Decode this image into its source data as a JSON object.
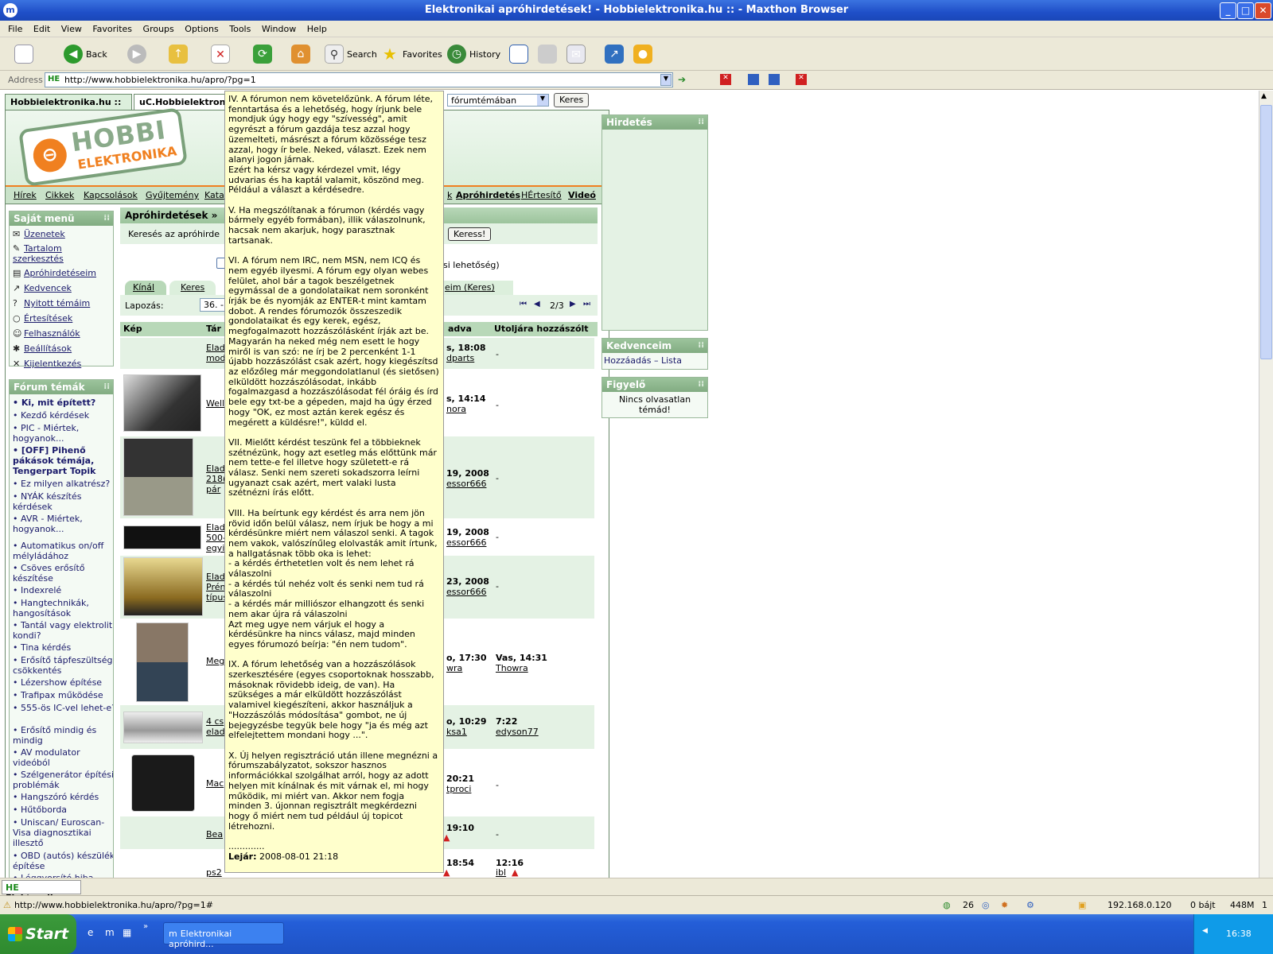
{
  "window": {
    "title": "Elektronikai apróhirdetések! - Hobbielektronika.hu :: - Maxthon Browser"
  },
  "menu": [
    "File",
    "Edit",
    "View",
    "Favorites",
    "Groups",
    "Options",
    "Tools",
    "Window",
    "Help"
  ],
  "toolbar": {
    "back": "Back",
    "search": "Search",
    "favorites": "Favorites",
    "history": "History"
  },
  "address": {
    "label": "Address",
    "url": "http://www.hobbielektronika.hu/apro/?pg=1"
  },
  "tabs": [
    "Hobbielektronika.hu ::",
    "uC.Hobbielektroni"
  ],
  "search_area": {
    "scope": "fórumtémában",
    "button": "Keres"
  },
  "nav": [
    "Hírek",
    "Cikkek",
    "Kapcsolások",
    "Gyűjtemény",
    "Kata",
    "k",
    "Apróhirdetés",
    "HÉrtesítő",
    "Videó"
  ],
  "sajat_menu": {
    "title": "Saját menü",
    "items": [
      "Üzenetek",
      "Tartalom szerkesztés",
      "Apróhirdetéseim",
      "Kedvencek",
      "Nyitott témáim",
      "Értesítések",
      "Felhasználók",
      "Beállítások",
      "Kijelentkezés"
    ]
  },
  "forum_temak": {
    "title": "Fórum témák",
    "items": [
      "Ki, mit épített?",
      "Kezdő kérdések",
      "PIC - Miértek, hogyanok...",
      "[OFF] Pihenő pákások témája, Tengerpart Topik",
      "Ez milyen alkatrész?",
      "NYÁK készítés kérdések",
      "AVR - Miértek, hogyanok...",
      "Automatikus on/off mélyládához",
      "Csöves erősítő készítése",
      "Indexrelé",
      "Hangtechnikák, hangosítások",
      "Tantál vagy elektrolit kondi?",
      "Tina kérdés",
      "Erősítő tápfeszültség csökkentés",
      "Lézershow építése",
      "Trafipax működése",
      "555-ös IC-vel lehet-e?",
      "Erősítő mindig és mindig",
      "AV modulator videóból",
      "Szélgenerátor építési problémák",
      "Hangszóró kérdés",
      "Hűtőborda",
      "Uniscan/ Euroscan-Visa diagnosztikai illesztő",
      "OBD (autós) készülék építése",
      "Léggyorsító hiba"
    ]
  },
  "main": {
    "title": "Apróhirdetések »",
    "search_label": "Keresés az apróhirde",
    "search_button": "Keress!",
    "extra_text": "si lehetőség)",
    "subtabs": [
      "Kínál",
      "Keres",
      "eim (Keres)"
    ],
    "paging_label": "Lapozás:",
    "paging_value": "36. - 70. hirdetés",
    "page_of": "2/3",
    "columns": [
      "Kép",
      "Tár",
      "adva",
      "Utoljára hozzászólt"
    ],
    "rows": [
      {
        "title": "Elad",
        "title2": "mod",
        "added": "s, 18:08",
        "added_user": "dparts",
        "last": "-",
        "last_user": ""
      },
      {
        "title": "Well",
        "title2": "",
        "added": "s, 14:14",
        "added_user": "nora",
        "last": "-",
        "last_user": ""
      },
      {
        "title": "Elad",
        "title2": "218(",
        "title3": "pár",
        "added": "19, 2008",
        "added_user": "essor666",
        "last": "-",
        "last_user": ""
      },
      {
        "title": "Elad",
        "title2": "500-",
        "title3": "egyi",
        "added": "19, 2008",
        "added_user": "essor666",
        "last": "-",
        "last_user": ""
      },
      {
        "title": "Elad",
        "title2": "Prén",
        "title3": "típus",
        "added": "23, 2008",
        "added_user": "essor666",
        "last": "-",
        "last_user": ""
      },
      {
        "title": "Meg",
        "title2": "",
        "added": "o, 17:30",
        "added_user": "wra",
        "last": "Vas, 14:31",
        "last_user": "Thowra"
      },
      {
        "title": "4 cs",
        "title2": "elad",
        "added": "o, 10:29",
        "added_user": "ksa1",
        "last": "7:22",
        "last_user": "edyson77"
      },
      {
        "title": "Mac",
        "title2": "",
        "added": "20:21",
        "added_user": "tproci",
        "last": "-",
        "last_user": ""
      },
      {
        "title": "Bea",
        "title2": "",
        "added": "19:10",
        "added_user": "",
        "last": "-",
        "last_user": ""
      },
      {
        "title": "ps2",
        "title2": "",
        "added": "18:54",
        "added_user": "",
        "last": "12:16",
        "last_user": "ibl"
      }
    ]
  },
  "tooltip": {
    "text": "IV. A fórumon nem követelőzünk. A fórum léte, fenntartása és a lehetőség, hogy írjunk bele mondjuk úgy hogy egy \"szívesség\", amit egyrészt a fórum gazdája tesz azzal hogy üzemelteti, másrészt a fórum közössége tesz azzal, hogy ír bele. Neked, választ. Ezek nem alanyi jogon járnak.\nEzért ha kérsz vagy kérdezel vmit, légy udvarias és ha kaptál valamit, köszönd meg. Például a választ a kérdésedre.\n\nV. Ha megszólítanak a fórumon (kérdés vagy bármely egyéb formában), illik válaszolnunk, hacsak nem akarjuk, hogy parasztnak tartsanak.\n\nVI. A fórum nem IRC, nem MSN, nem ICQ és nem egyéb ilyesmi. A fórum egy olyan webes felület, ahol bár a tagok beszélgetnek egymással de a gondolataikat nem soronként írják be és nyomják az ENTER-t mint kamtam dobot. A rendes fórumozók összeszedik gondolataikat és egy kerek, egész, megfogalmazott hozzászólásként írják azt be.\nMagyarán ha neked még nem esett le hogy miről is van szó: ne írj be 2 percenként 1-1 újabb hozzászólást csak azért, hogy kiegészítsd az előzőleg már meggondolatlanul (és sietősen) elküldött hozzászólásodat, inkább fogalmazgasd a hozzászólásodat fél óráig és írd bele egy txt-be a gépeden, majd ha úgy érzed hogy \"OK, ez most aztán kerek egész és megérett a küldésre!\", küldd el.\n\nVII. Mielőtt kérdést teszünk fel a többieknek szétnézünk, hogy azt esetleg más előttünk már nem tette-e fel illetve hogy született-e rá válasz. Senki nem szereti sokadszorra leírni ugyanazt csak azért, mert valaki lusta szétnézni írás előtt.\n\nVIII. Ha beírtunk egy kérdést és arra nem jön rövid időn belül válasz, nem írjuk be hogy a mi kérdésünkre miért nem válaszol senki. A tagok nem vakok, valószínűleg elolvasták amit írtunk, a hallgatásnak több oka is lehet:\n- a kérdés érthetetlen volt és nem lehet rá válaszolni\n- a kérdés túl nehéz volt és senki nem tud rá válaszolni\n- a kérdés már milliószor elhangzott és senki nem akar újra rá válaszolni\nAzt meg ugye nem várjuk el hogy a kérdésünkre ha nincs válasz, majd minden egyes fórumozó beírja: \"én nem tudom\".\n\nIX. A fórum lehetőség van a hozzászólások szerkesztésére (egyes csoportoknak hosszabb, másoknak rövidebb ideig, de van). Ha szükséges a már elküldött hozzászólást valamivel kiegészíteni, akkor használjuk a \"Hozzászólás módosítása\" gombot, ne új bejegyzésbe tegyük bele hogy \"ja és még azt elfelejtettem mondani hogy ...\".\n\nX. Új helyen regisztráció után illene megnézni a fórumszabályzatot, sokszor hasznos információkkal szolgálhat arról, hogy az adott helyen mit kínálnak és mit várnak el, mi hogy működik, mi miért van. Akkor nem fogja minden 3. újonnan regisztrált megkérdezni hogy ő miért nem tud például új topicot létrehozni.\n\n.............",
    "expiry_label": "Lejár:",
    "expiry_value": "2008-08-01 21:18"
  },
  "sidebar": {
    "hirdetes": "Hirdetés",
    "kedvenceim": "Kedvenceim",
    "hozzaadas": "Hozzáadás",
    "lista": "Lista",
    "dash": "–",
    "figyelo": "Figyelő",
    "figyelo_text": "Nincs olvasatlan témád!"
  },
  "tabstrip": {
    "tab": "Elektronika..."
  },
  "status": {
    "url": "http://www.hobbielektronika.hu/apro/?pg=1#",
    "count": "26",
    "ip": "192.168.0.120",
    "bytes": "0 bájt",
    "mem": "448M",
    "num": "1"
  },
  "taskbar": {
    "start": "Start",
    "item": "Elektronikai apróhird...",
    "clock": "16:38"
  },
  "colors": {
    "accent": "#f08020",
    "green": "#9cc49c",
    "tooltip": "#ffffcc"
  }
}
